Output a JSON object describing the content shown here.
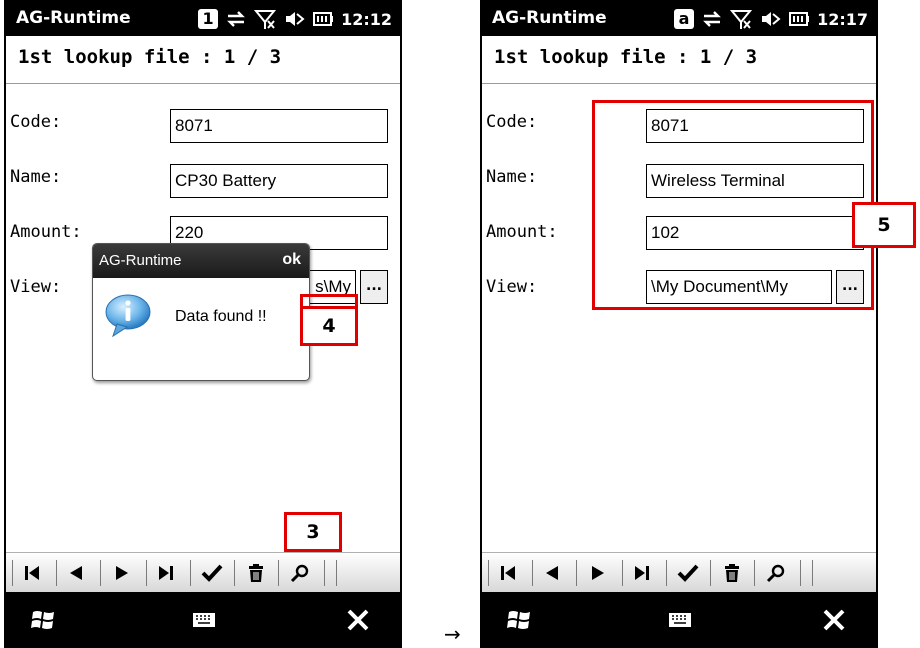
{
  "app": {
    "title": "AG-Runtime"
  },
  "screens": [
    {
      "status": {
        "input_mode": "1",
        "time": "12:12"
      },
      "header": "1st lookup file : 1 / 3",
      "fields": {
        "code": {
          "label": "Code:",
          "value": "8071"
        },
        "name": {
          "label": "Name:",
          "value": "CP30 Battery"
        },
        "amount": {
          "label": "Amount:",
          "value": "220"
        },
        "view": {
          "label": "View:",
          "value": "s\\My",
          "button": "..."
        }
      },
      "popup": {
        "title": "AG-Runtime",
        "ok_label": "ok",
        "message": "Data found !!",
        "icon": "info-icon"
      }
    },
    {
      "status": {
        "input_mode": "a",
        "time": "12:17"
      },
      "header": "1st lookup file : 1 / 3",
      "fields": {
        "code": {
          "label": "Code:",
          "value": "8071"
        },
        "name": {
          "label": "Name:",
          "value": "Wireless Terminal"
        },
        "amount": {
          "label": "Amount:",
          "value": "102"
        },
        "view": {
          "label": "View:",
          "value": "\\My Document\\My",
          "button": "..."
        }
      }
    }
  ],
  "toolbar_icons": [
    "first-record-icon",
    "previous-record-icon",
    "next-record-icon",
    "last-record-icon",
    "confirm-icon",
    "delete-icon",
    "search-icon"
  ],
  "taskbar_icons": [
    "windows-start-icon",
    "keyboard-icon",
    "close-icon"
  ],
  "callouts": {
    "step3": "3",
    "step4": "4",
    "step5": "5"
  },
  "transition_arrow": "→",
  "colors": {
    "callout": "#e00000",
    "status_bar": "#000000",
    "popup_title": "#2a2a2a"
  }
}
